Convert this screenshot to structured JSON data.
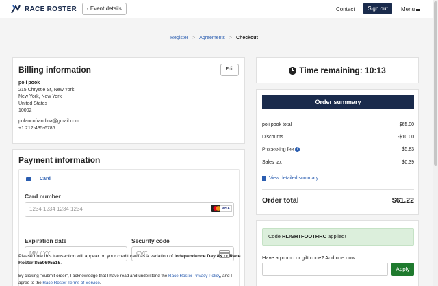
{
  "header": {
    "logo_text": "RACE ROSTER",
    "event_details_label": "Event details",
    "contact_label": "Contact",
    "signout_label": "Sign out",
    "menu_label": "Menu"
  },
  "breadcrumb": {
    "items": [
      "Register",
      "Agreements",
      "Checkout"
    ]
  },
  "billing": {
    "title": "Billing information",
    "edit_label": "Edit",
    "name": "poli pook",
    "address": [
      "215 Chrystie St, New York",
      "New York, New York",
      "United States",
      "10002"
    ],
    "email": "polancofrandina@gmail.com",
    "phone": "+1 212-435-6786"
  },
  "payment": {
    "title": "Payment information",
    "tab_label": "Card",
    "card_number_label": "Card number",
    "card_number_placeholder": "1234 1234 1234 1234",
    "visa_text": "VISA",
    "expiration_label": "Expiration date",
    "expiration_placeholder": "MM / YY",
    "security_label": "Security code",
    "security_placeholder": "CVC",
    "cvc_icon_text": "123",
    "note_prefix": "Please note this transaction will appear on your credit card as a variation of ",
    "note_event": "Independence Day 8K",
    "note_or": " or ",
    "note_descriptor": "Race Roster 8559695515",
    "note_suffix": ".",
    "terms_prefix": "By clicking \"Submit order\", I acknowledge that I have read and understand the ",
    "terms_privacy_link": "Race Roster Privacy Policy",
    "terms_middle": ", and I agree to the ",
    "terms_tos_link": "Race Roster Terms of Service",
    "terms_suffix": "."
  },
  "timer": {
    "label": "Time remaining: 10:13"
  },
  "summary": {
    "title": "Order summary",
    "rows": [
      {
        "label": "poli pook total",
        "value": "$65.00"
      },
      {
        "label": "Discounts",
        "value": "-$10.00"
      },
      {
        "label": "Processing fee",
        "value": "$5.83"
      },
      {
        "label": "Sales tax",
        "value": "$0.39"
      }
    ],
    "detail_link": "View detailed summary",
    "total_label": "Order total",
    "total_value": "$61.22"
  },
  "promo": {
    "applied_prefix": "Code ",
    "applied_code": "HLIGHTFOOTHRC",
    "applied_suffix": " applied!",
    "prompt": "Have a promo or gift code? Add one now",
    "input_value": "",
    "apply_label": "Apply"
  },
  "colors": {
    "navy": "#1a2b4c",
    "link_blue": "#2a5db0",
    "apply_green": "#1f7a2e",
    "success_bg": "#dcefdc"
  }
}
